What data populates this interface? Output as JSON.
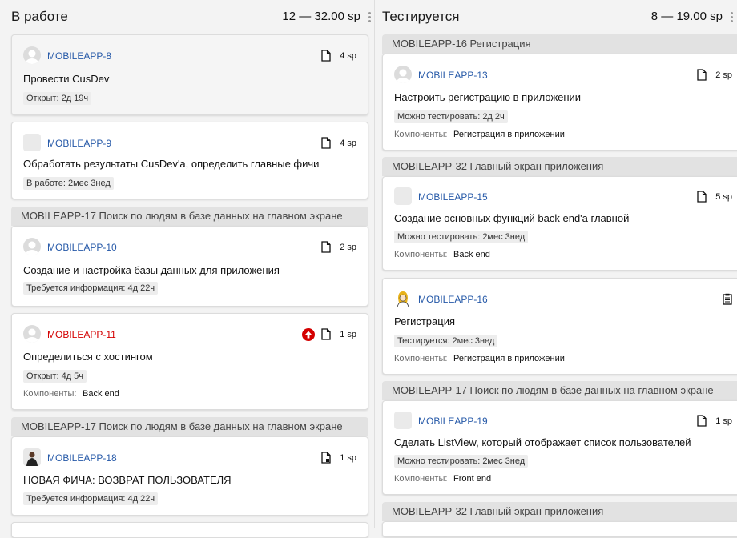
{
  "columns": [
    {
      "title": "В работе",
      "total": "12 — 32.00 sp",
      "epic_headers": [
        "MOBILEAPP-17 Поиск по людям в базе данных на главном экране",
        "MOBILEAPP-17 Поиск по людям в базе данных на главном экране"
      ],
      "cards": [
        {
          "key": "MOBILEAPP-8",
          "sp": "4 sp",
          "title": "Провести CusDev",
          "status": "Открыт: 2д 19ч"
        },
        {
          "key": "MOBILEAPP-9",
          "sp": "4 sp",
          "title": "Обработать результаты CusDev'а, определить главные фичи",
          "status": "В работе: 2мес 3нед"
        },
        {
          "key": "MOBILEAPP-10",
          "sp": "2 sp",
          "title": "Создание и настройка базы данных для приложения",
          "status": "Требуется информация: 4д 22ч"
        },
        {
          "key": "MOBILEAPP-11",
          "sp": "1 sp",
          "title": "Определиться с хостингом",
          "status": "Открыт: 4д 5ч",
          "components_label": "Компоненты:",
          "components": "Back end"
        },
        {
          "key": "MOBILEAPP-18",
          "sp": "1 sp",
          "title": "НОВАЯ ФИЧА: ВОЗВРАТ ПОЛЬЗОВАТЕЛЯ",
          "status": "Требуется информация: 4д 22ч"
        }
      ]
    },
    {
      "title": "Тестируется",
      "total": "8 — 19.00 sp",
      "epic_headers": [
        "MOBILEAPP-16 Регистрация",
        "MOBILEAPP-32 Главный экран приложения",
        "MOBILEAPP-17 Поиск по людям в базе данных на главном экране",
        "MOBILEAPP-32 Главный экран приложения"
      ],
      "cards": [
        {
          "key": "MOBILEAPP-13",
          "sp": "2 sp",
          "title": "Настроить регистрацию в приложении",
          "status": "Можно тестировать: 2д 2ч",
          "components_label": "Компоненты:",
          "components": "Регистрация в приложении"
        },
        {
          "key": "MOBILEAPP-15",
          "sp": "5 sp",
          "title": "Создание основных функций back end'а главной",
          "status": "Можно тестировать: 2мес 3нед",
          "components_label": "Компоненты:",
          "components": "Back end"
        },
        {
          "key": "MOBILEAPP-16",
          "title": "Регистрация",
          "status": "Тестируется: 2мес 3нед",
          "components_label": "Компоненты:",
          "components": "Регистрация в приложении"
        },
        {
          "key": "MOBILEAPP-19",
          "sp": "1 sp",
          "title": "Сделать  ListView, который отображает список пользователей",
          "status": "Можно тестировать: 2мес 3нед",
          "components_label": "Компоненты:",
          "components": "Front end"
        }
      ]
    }
  ],
  "colors": {
    "link": "#2659a8",
    "priority": "#d40000",
    "epic_bg": "#e2e2e2"
  }
}
